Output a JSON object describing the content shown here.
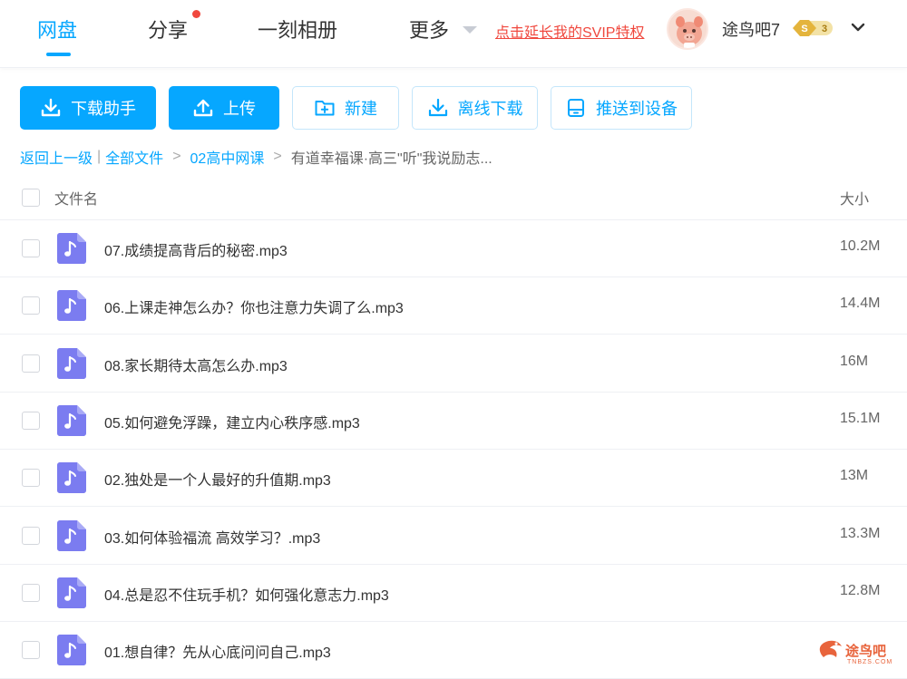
{
  "nav": {
    "items": [
      {
        "label": "网盘",
        "active": true
      },
      {
        "label": "分享"
      },
      {
        "label": "一刻相册"
      },
      {
        "label": "更多"
      }
    ],
    "svip_link": "点击延长我的SVIP特权",
    "username": "途鸟吧7",
    "vip_level": "3",
    "vip_letter": "S"
  },
  "toolbar": {
    "download_helper": "下载助手",
    "upload": "上传",
    "new_folder": "新建",
    "offline_download": "离线下载",
    "push_device": "推送到设备"
  },
  "breadcrumb": {
    "back": "返回上一级",
    "all_files": "全部文件",
    "folder": "02高中网课",
    "current": "有道幸福课·高三\"听\"我说励志..."
  },
  "list": {
    "header_name": "文件名",
    "header_size": "大小",
    "files": [
      {
        "name": "07.成绩提高背后的秘密.mp3",
        "size": "10.2M"
      },
      {
        "name": "06.上课走神怎么办？你也注意力失调了么.mp3",
        "size": "14.4M"
      },
      {
        "name": "08.家长期待太高怎么办.mp3",
        "size": "16M"
      },
      {
        "name": "05.如何避免浮躁，建立内心秩序感.mp3",
        "size": "15.1M"
      },
      {
        "name": "02.独处是一个人最好的升值期.mp3",
        "size": "13M"
      },
      {
        "name": "03.如何体验福流 高效学习？.mp3",
        "size": "13.3M"
      },
      {
        "name": "04.总是忍不住玩手机？如何强化意志力.mp3",
        "size": "12.8M"
      },
      {
        "name": "01.想自律？先从心底问问自己.mp3",
        "size": ""
      }
    ]
  },
  "watermark": {
    "text": "途鸟吧",
    "sub": "TNBZS.COM"
  },
  "colors": {
    "accent": "#06a7ff",
    "red": "#f0483e",
    "audio_icon": "#7b7cf0"
  }
}
